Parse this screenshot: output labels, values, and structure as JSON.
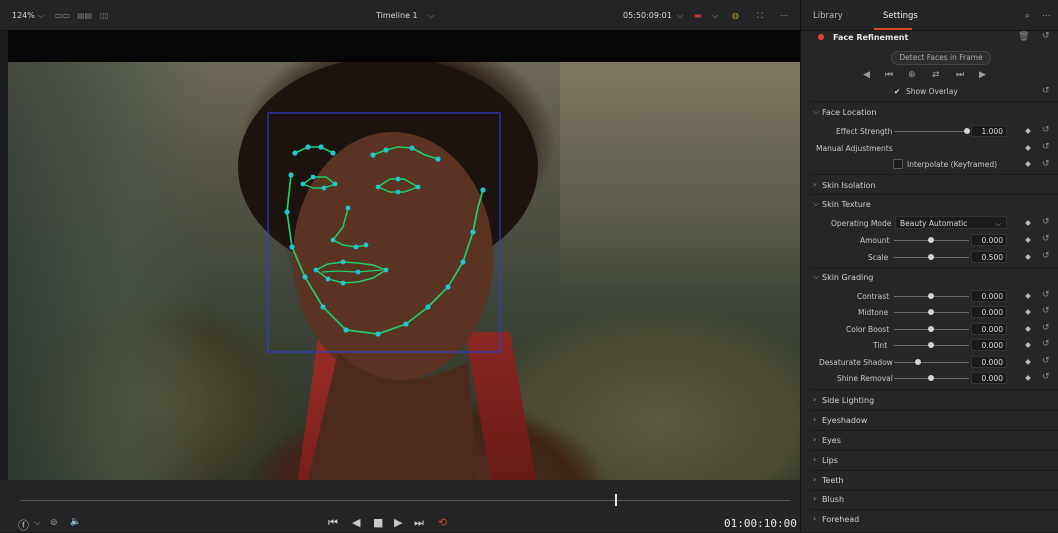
{
  "viewer": {
    "zoom": "124%",
    "timeline_title": "Timeline 1",
    "source_timecode": "05:50:09:01",
    "playhead_timecode": "01:00:10:00",
    "face_box_color": "#2f3bd6",
    "tracking_color": "#1fd16a"
  },
  "panel": {
    "tabs": {
      "library": "Library",
      "settings": "Settings"
    },
    "effect_title": "Face Refinement",
    "detect_button": "Detect Faces in Frame",
    "show_overlay": {
      "label": "Show Overlay",
      "checked": true
    },
    "face_location": {
      "header": "Face Location",
      "effect_strength": {
        "label": "Effect Strength",
        "value": "1.000"
      },
      "manual_adjustments": "Manual Adjustments",
      "interpolate": "Interpolate (Keyframed)"
    },
    "skin_isolation": "Skin Isolation",
    "skin_texture": {
      "header": "Skin Texture",
      "operating_mode": {
        "label": "Operating Mode",
        "value": "Beauty Automatic"
      },
      "amount": {
        "label": "Amount",
        "value": "0.000"
      },
      "scale": {
        "label": "Scale",
        "value": "0.500"
      }
    },
    "skin_grading": {
      "header": "Skin Grading",
      "contrast": {
        "label": "Contrast",
        "value": "0.000"
      },
      "midtone": {
        "label": "Midtone",
        "value": "0.000"
      },
      "color_boost": {
        "label": "Color Boost",
        "value": "0.000"
      },
      "tint": {
        "label": "Tint",
        "value": "0.000"
      },
      "desaturate_shadow": {
        "label": "Desaturate Shadow",
        "value": "0.000"
      },
      "shine_removal": {
        "label": "Shine Removal",
        "value": "0.000"
      }
    },
    "collapsed_sections": [
      "Side Lighting",
      "Eyeshadow",
      "Eyes",
      "Lips",
      "Teeth",
      "Blush",
      "Forehead"
    ]
  }
}
